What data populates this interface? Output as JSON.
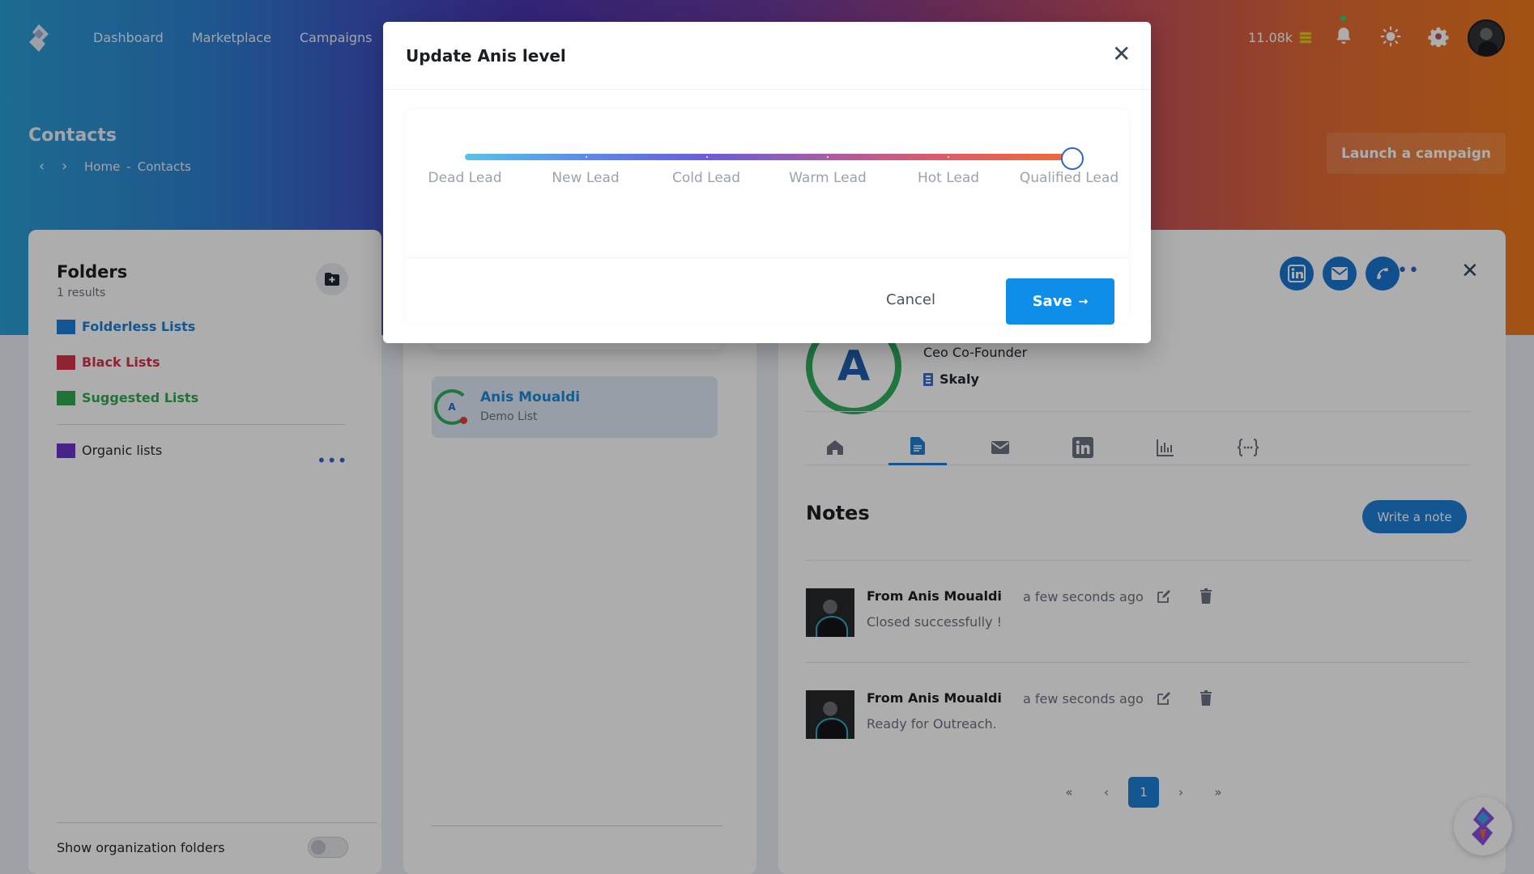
{
  "nav": {
    "items": [
      "Dashboard",
      "Marketplace",
      "Campaigns"
    ],
    "credits": "11.08k"
  },
  "page": {
    "title": "Contacts",
    "breadcrumb": [
      "Home",
      "Contacts"
    ],
    "breadcrumb_sep": "-",
    "launch_label": "Launch a campaign"
  },
  "folders": {
    "title": "Folders",
    "count": "1 results",
    "items": [
      {
        "label": "Folderless Lists",
        "color": "#1c7fd6"
      },
      {
        "label": "Black Lists",
        "color": "#d6334a"
      },
      {
        "label": "Suggested Lists",
        "color": "#34a853"
      }
    ],
    "organic": {
      "label": "Organic lists",
      "color": "#6b35c9"
    },
    "show_org_label": "Show organization folders"
  },
  "contact_list": {
    "items": [
      {
        "initial": "A",
        "name": "Anis Moualdi",
        "list": "Demo List"
      }
    ]
  },
  "profile": {
    "initial": "A",
    "job": "Ceo Co-Founder",
    "company": "Skaly",
    "notes_title": "Notes",
    "write_note_label": "Write a note",
    "notes": [
      {
        "from": "From Anis Moualdi",
        "time": "a few seconds ago",
        "text": "Closed successfully !"
      },
      {
        "from": "From Anis Moualdi",
        "time": "a few seconds ago",
        "text": "Ready for Outreach."
      }
    ],
    "pager": {
      "first": "«",
      "prev": "‹",
      "current": "1",
      "next": "›",
      "last": "»"
    },
    "tabs": [
      "home-icon",
      "document-icon",
      "mail-icon",
      "linkedin-icon",
      "chart-icon",
      "variables-icon"
    ]
  },
  "modal": {
    "title": "Update Anis level",
    "levels": [
      "Dead Lead",
      "New Lead",
      "Cold Lead",
      "Warm Lead",
      "Hot Lead",
      "Qualified Lead"
    ],
    "selected_level": "Qualified Lead",
    "cancel_label": "Cancel",
    "save_label": "Save",
    "save_arrow": "→"
  },
  "colors": {
    "accent": "#1c7fd6",
    "save": "#0e8ee9",
    "success": "#2fae5d"
  }
}
